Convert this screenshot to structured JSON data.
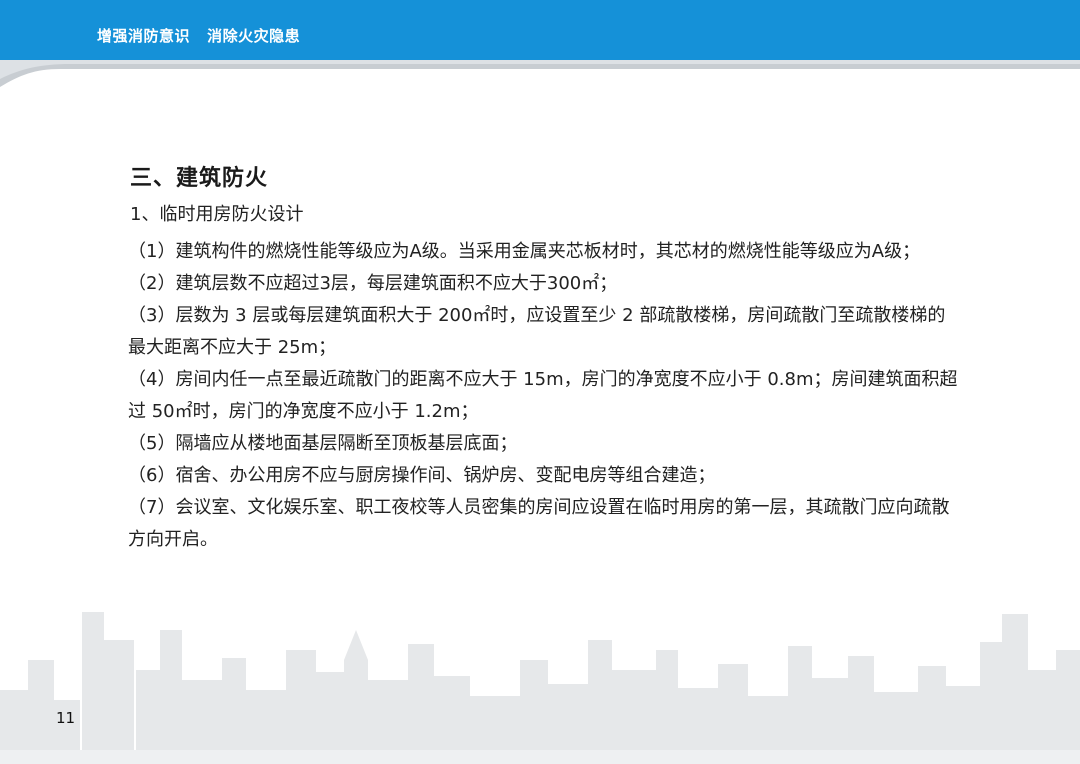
{
  "header": {
    "title": "增强消防意识   消除火灾隐患"
  },
  "section": {
    "heading": "三、建筑防火",
    "subheading": "1、临时用房防火设计",
    "items": [
      "（1）建筑构件的燃烧性能等级应为A级。当采用金属夹芯板材时，其芯材的燃烧性能等级应为A级；",
      "（2）建筑层数不应超过3层，每层建筑面积不应大于300㎡；",
      "（3）层数为 3 层或每层建筑面积大于 200㎡时，应设置至少 2 部疏散楼梯，房间疏散门至疏散楼梯的最大距离不应大于 25m；",
      "（4）房间内任一点至最近疏散门的距离不应大于 15m，房门的净宽度不应小于 0.8m；房间建筑面积超过 50㎡时，房门的净宽度不应小于 1.2m；",
      "（5）隔墙应从楼地面基层隔断至顶板基层底面；",
      "（6）宿舍、办公用房不应与厨房操作间、锅炉房、变配电房等组合建造；",
      "（7）会议室、文化娱乐室、职工夜校等人员密集的房间应设置在临时用房的第一层，其疏散门应向疏散方向开启。"
    ]
  },
  "page_number": "11",
  "colors": {
    "header": "#1591d8",
    "skyline": "#e6e8ea"
  }
}
